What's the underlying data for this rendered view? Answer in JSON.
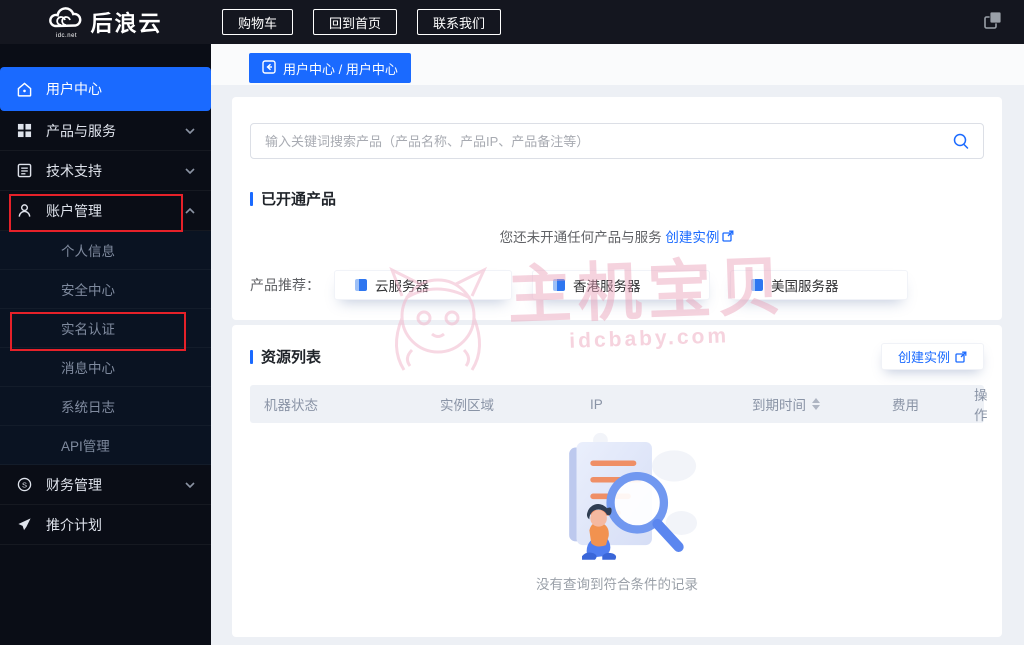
{
  "header": {
    "logo_title": "后浪云",
    "logo_subtitle": "idc.net",
    "nav_buttons": [
      {
        "label": "购物车"
      },
      {
        "label": "回到首页"
      },
      {
        "label": "联系我们"
      }
    ]
  },
  "sidebar": {
    "items": [
      {
        "label": "用户中心",
        "icon": "home-icon",
        "active": true
      },
      {
        "label": "产品与服务",
        "icon": "grid-icon",
        "chevron": "down"
      },
      {
        "label": "技术支持",
        "icon": "document-icon",
        "chevron": "down"
      },
      {
        "label": "账户管理",
        "icon": "user-icon",
        "chevron": "up",
        "annotated": true
      },
      {
        "label": "财务管理",
        "icon": "finance-icon",
        "chevron": "down"
      },
      {
        "label": "推介计划",
        "icon": "promote-icon"
      }
    ],
    "account_sub_items": [
      {
        "label": "个人信息"
      },
      {
        "label": "安全中心"
      },
      {
        "label": "实名认证",
        "annotated": true
      },
      {
        "label": "消息中心"
      },
      {
        "label": "系统日志"
      },
      {
        "label": "API管理"
      }
    ]
  },
  "breadcrumb": {
    "label": "用户中心 / 用户中心"
  },
  "overview": {
    "search_placeholder": "输入关键词搜索产品（产品名称、产品IP、产品备注等）",
    "opened_title": "已开通产品",
    "empty_text": "您还未开通任何产品与服务",
    "create_link_label": "创建实例",
    "recommend_label": "产品推荐：",
    "recommended_products": [
      {
        "name": "云服务器"
      },
      {
        "name": "香港服务器"
      },
      {
        "name": "美国服务器"
      }
    ]
  },
  "resources": {
    "title": "资源列表",
    "create_button_label": "创建实例",
    "columns": [
      {
        "label": "机器状态"
      },
      {
        "label": "实例区域"
      },
      {
        "label": "IP"
      },
      {
        "label": "到期时间",
        "sortable": true
      },
      {
        "label": "费用"
      },
      {
        "label": "操作"
      }
    ],
    "empty_text": "没有查询到符合条件的记录"
  },
  "watermark": {
    "text": "主机宝贝",
    "site": "idcbaby.com"
  },
  "colors": {
    "accent_blue": "#1a6aff",
    "header_bg": "#14161f",
    "sidebar_bg": "#0a0d16",
    "content_bg": "#edf0f5",
    "annotation_red": "#e62129",
    "table_header_bg": "#eef1f6"
  }
}
